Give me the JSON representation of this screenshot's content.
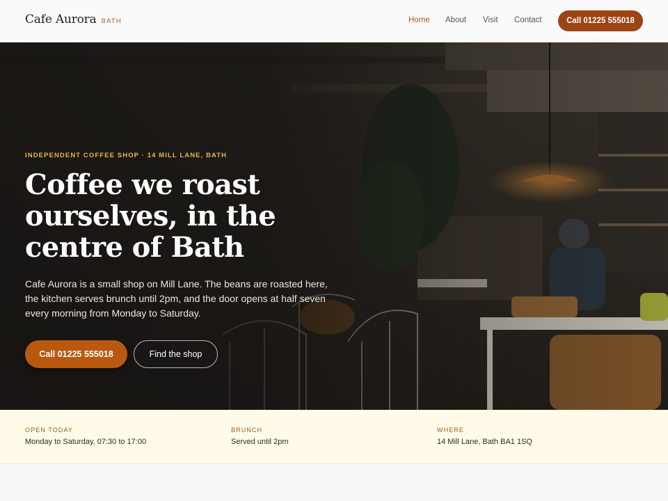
{
  "nav": {
    "brand_name": "Cafe Aurora",
    "brand_city": "BATH",
    "links": [
      {
        "label": "Home",
        "active": true
      },
      {
        "label": "About",
        "active": false
      },
      {
        "label": "Visit",
        "active": false
      },
      {
        "label": "Contact",
        "active": false
      }
    ],
    "call_label": "Call 01225 555018"
  },
  "hero": {
    "eyebrow": "INDEPENDENT COFFEE SHOP · 14 MILL LANE, BATH",
    "headline": "Coffee we roast ourselves, in the centre of Bath",
    "lede": "Cafe Aurora is a small shop on Mill Lane. The beans are roasted here, the kitchen serves brunch until 2pm, and the door opens at half seven every morning from Monday to Saturday.",
    "primary_label": "Call 01225 555018",
    "secondary_label": "Find the shop"
  },
  "info": [
    {
      "label": "OPEN TODAY",
      "value": "Monday to Saturday, 07:30 to 17:00"
    },
    {
      "label": "BRUNCH",
      "value": "Served until 2pm"
    },
    {
      "label": "WHERE",
      "value": "14 Mill Lane, Bath BA1 1SQ"
    }
  ],
  "colors": {
    "accent": "#b9590f",
    "accent_dark": "#9c4413",
    "eyebrow": "#e8b64c",
    "info_bg": "#fffbe8"
  }
}
